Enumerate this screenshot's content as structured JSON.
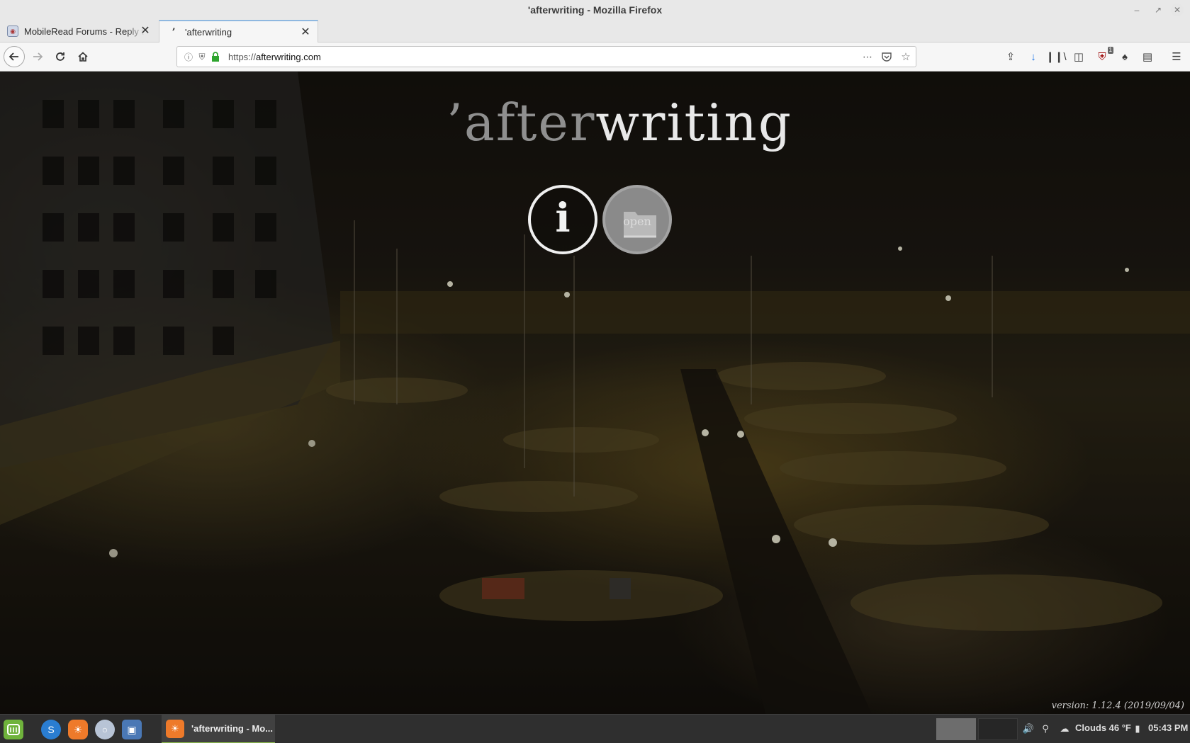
{
  "window": {
    "title": "'afterwriting - Mozilla Firefox",
    "controls": [
      "minimize-icon",
      "maximize-icon",
      "close-icon"
    ]
  },
  "tabs": [
    {
      "label": "MobileRead Forums - Reply to",
      "active": false,
      "favicon": "mobileread-icon"
    },
    {
      "label": "'afterwriting",
      "active": true,
      "favicon": "afterwriting-icon"
    }
  ],
  "navbar": {
    "url_prefix": "https://",
    "url_host": "afterwriting.com",
    "toolbar_badge": "1"
  },
  "page": {
    "logo_prefix": "’after",
    "logo_suffix": "writing",
    "info_glyph": "i",
    "open_label": "open",
    "version": "version: 1.12.4 (2019/09/04)"
  },
  "taskbar": {
    "window_label": "'afterwriting - Mo...",
    "weather": "Clouds 46 °F",
    "clock": "05:43 PM"
  },
  "colors": {
    "accent_green": "#8fbf4f",
    "firefox_orange": "#ee7a2a",
    "tab_highlight": "#8fb8e0"
  }
}
